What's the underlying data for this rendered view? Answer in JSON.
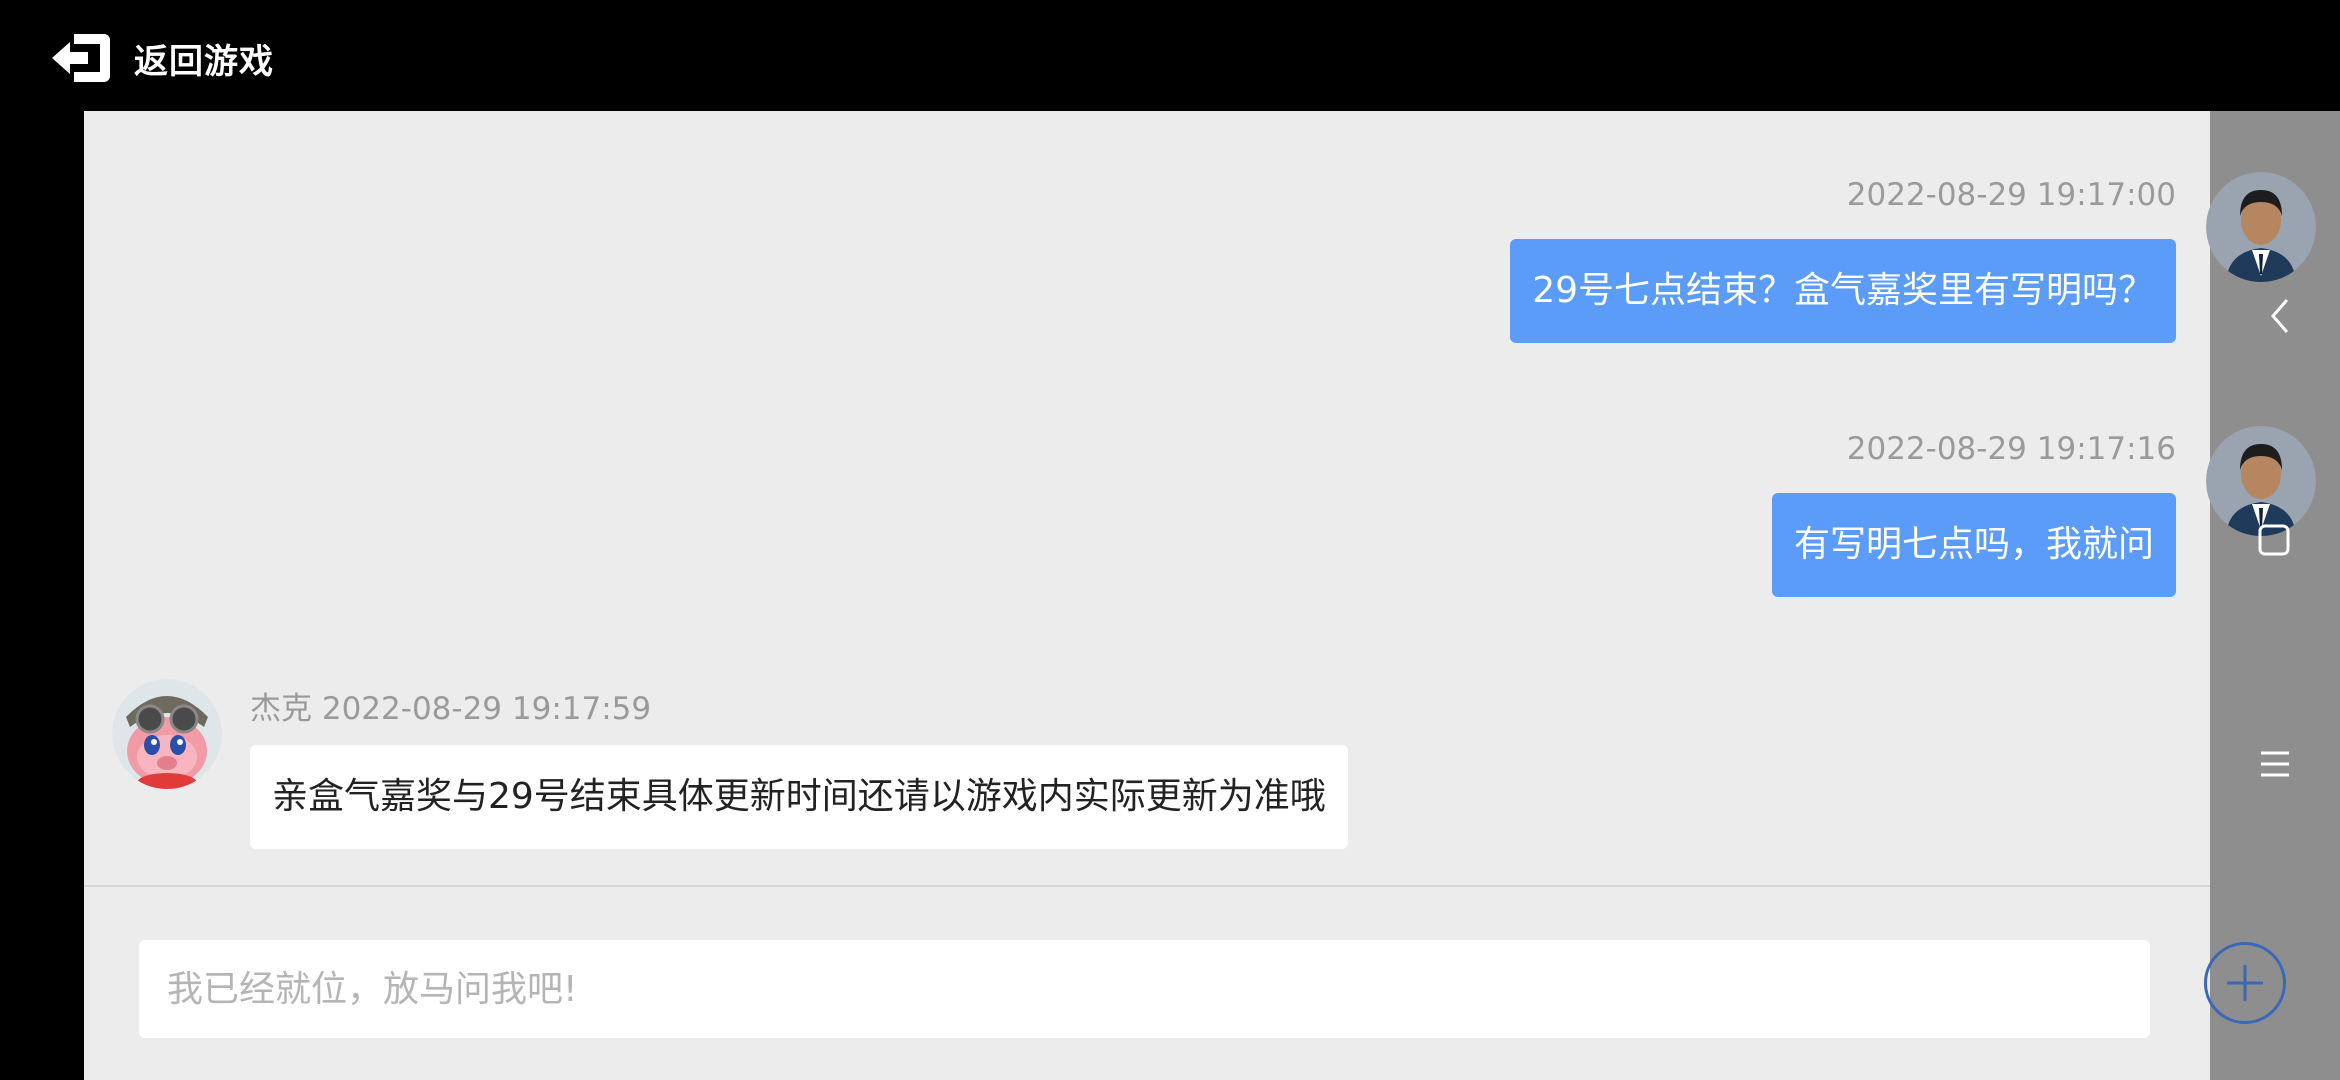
{
  "header": {
    "back_label": "返回游戏"
  },
  "messages": [
    {
      "from": "me",
      "timestamp": "2022-08-29 19:17:00",
      "text": "29号七点结束？盒气嘉奖里有写明吗？"
    },
    {
      "from": "me",
      "timestamp": "2022-08-29 19:17:16",
      "text": "有写明七点吗，我就问"
    },
    {
      "from": "agent",
      "sender": "杰克",
      "timestamp": "2022-08-29 19:17:59",
      "text": "亲盒气嘉奖与29号结束具体更新时间还请以游戏内实际更新为准哦"
    }
  ],
  "input": {
    "placeholder": "我已经就位，放马问我吧!"
  },
  "colors": {
    "my_bubble": "#5b9cf9",
    "their_bubble": "#ffffff",
    "chat_bg": "#ececec",
    "side_panel": "#8e8e8e",
    "plus_ring": "#3b67b8"
  },
  "icons": {
    "back": "exit-arrow-icon",
    "nav_back": "chevron-left-icon",
    "nav_home": "square-icon",
    "nav_menu": "hamburger-menu-icon",
    "add": "plus-circle-icon"
  }
}
